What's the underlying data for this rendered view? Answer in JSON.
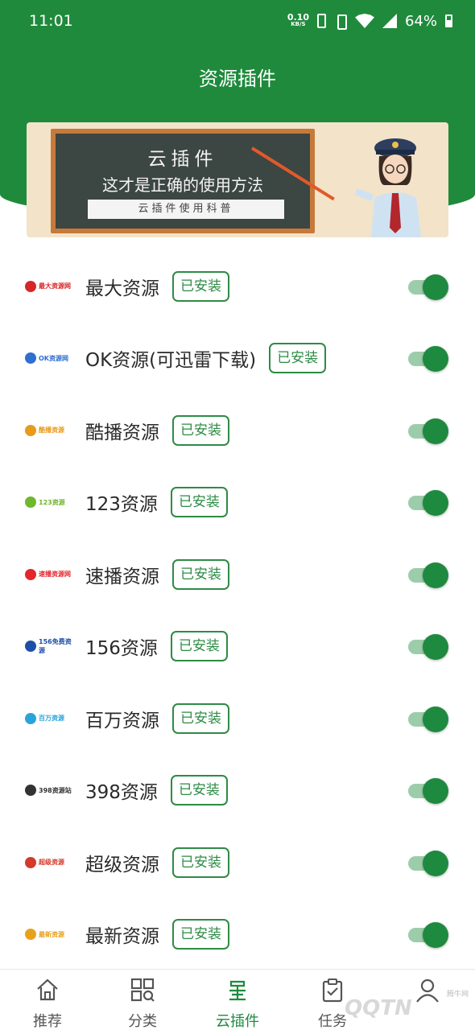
{
  "status_bar": {
    "time": "11:01",
    "net_speed": "0.10",
    "net_unit": "KB/S",
    "battery": "64%"
  },
  "header": {
    "title": "资源插件"
  },
  "banner": {
    "line1": "云插件",
    "line2": "这才是正确的使用方法",
    "subtitle": "云插件使用科普"
  },
  "badge_label": "已安装",
  "plugins": [
    {
      "name": "最大资源",
      "logo_text": "最大资源网",
      "logo_color": "#d7262a",
      "enabled": true
    },
    {
      "name": "OK资源(可迅雷下载)",
      "logo_text": "OK资源网",
      "logo_color": "#2e6fd0",
      "enabled": true
    },
    {
      "name": "酷播资源",
      "logo_text": "酷播资源",
      "logo_color": "#e89a1b",
      "enabled": true
    },
    {
      "name": "123资源",
      "logo_text": "123资源",
      "logo_color": "#6fb72e",
      "enabled": true
    },
    {
      "name": "速播资源",
      "logo_text": "速播资源网",
      "logo_color": "#e3262d",
      "enabled": true
    },
    {
      "name": "156资源",
      "logo_text": "156免费资源",
      "logo_color": "#1d4fa8",
      "enabled": true
    },
    {
      "name": "百万资源",
      "logo_text": "百万资源",
      "logo_color": "#2aa3d8",
      "enabled": true
    },
    {
      "name": "398资源",
      "logo_text": "398资源站",
      "logo_color": "#333333",
      "enabled": true
    },
    {
      "name": "超级资源",
      "logo_text": "超级资源",
      "logo_color": "#d23a2a",
      "enabled": true
    },
    {
      "name": "最新资源",
      "logo_text": "最新资源",
      "logo_color": "#e7a21c",
      "enabled": true
    }
  ],
  "bottom_nav": [
    {
      "label": "推荐",
      "icon": "home-icon",
      "active": false
    },
    {
      "label": "分类",
      "icon": "category-grid-icon",
      "active": false
    },
    {
      "label": "云插件",
      "icon": "plugin-icon",
      "active": true
    },
    {
      "label": "任务",
      "icon": "clipboard-check-icon",
      "active": false
    },
    {
      "label": "",
      "icon": "profile-icon",
      "active": false
    }
  ],
  "watermark": {
    "text": "QQTN",
    "small": "腾牛网"
  },
  "colors": {
    "primary": "#1f8a3c",
    "toggle_on": "#1e8a3f",
    "badge": "#2e8b46"
  }
}
